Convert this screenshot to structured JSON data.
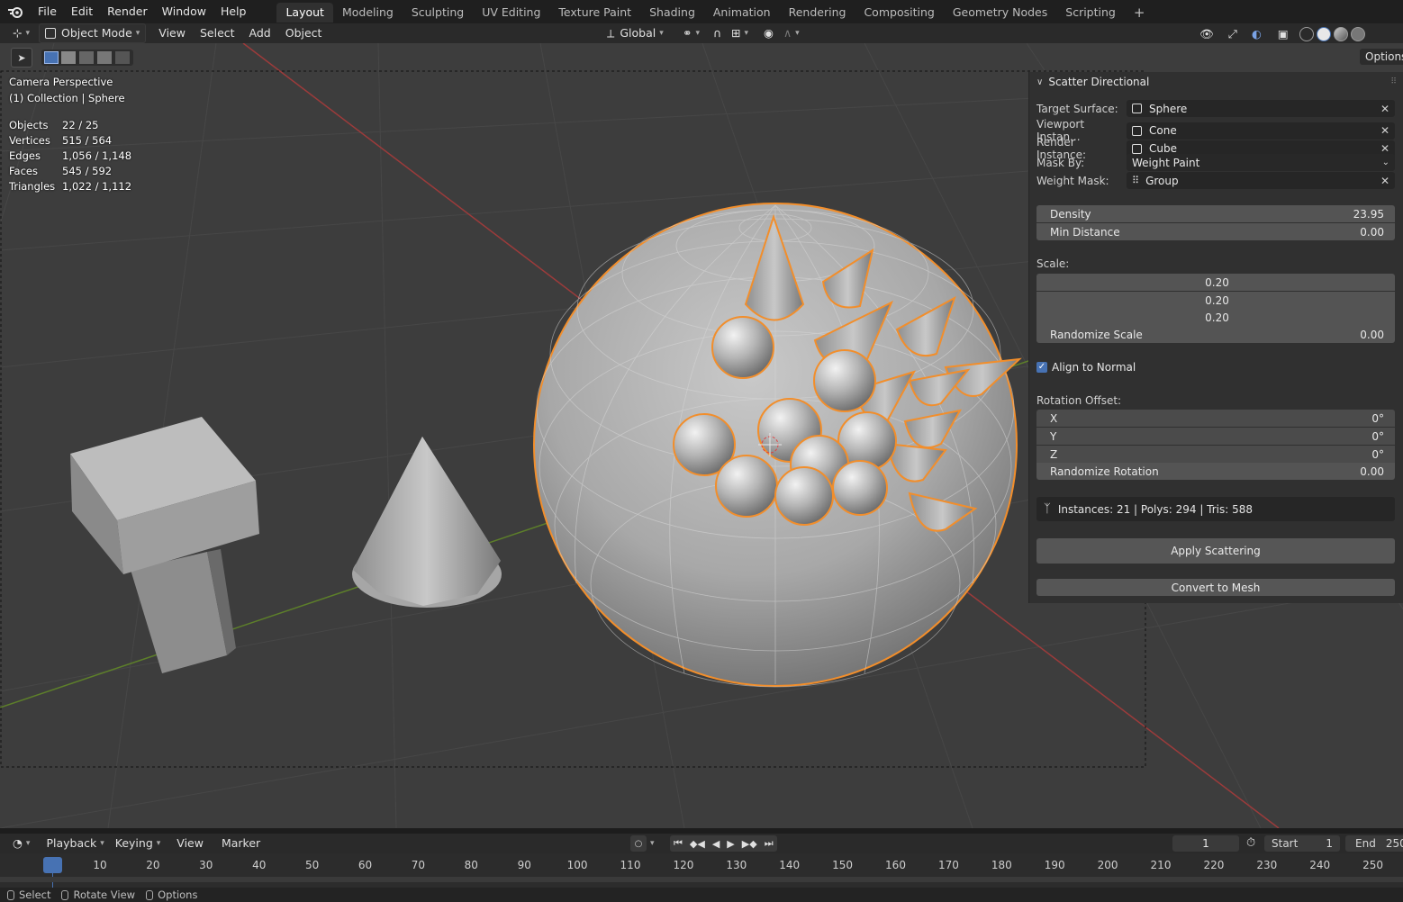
{
  "topbar": {
    "menus": [
      "File",
      "Edit",
      "Render",
      "Window",
      "Help"
    ],
    "workspace_tabs": [
      "Layout",
      "Modeling",
      "Sculpting",
      "UV Editing",
      "Texture Paint",
      "Shading",
      "Animation",
      "Rendering",
      "Compositing",
      "Geometry Nodes",
      "Scripting"
    ],
    "active_tab": "Layout",
    "add_tab": "+"
  },
  "header": {
    "mode": "Object Mode",
    "menus": [
      "View",
      "Select",
      "Add",
      "Object"
    ],
    "transform_orientation": "Global",
    "options_label": "Options"
  },
  "overlay": {
    "view_name": "Camera Perspective",
    "collection": "(1) Collection | Sphere",
    "stats": [
      {
        "label": "Objects",
        "value": "22 / 25"
      },
      {
        "label": "Vertices",
        "value": "515 / 564"
      },
      {
        "label": "Edges",
        "value": "1,056 / 1,148"
      },
      {
        "label": "Faces",
        "value": "545 / 592"
      },
      {
        "label": "Triangles",
        "value": "1,022 / 1,112"
      }
    ]
  },
  "panel": {
    "title": "Scatter Directional",
    "target_surface": {
      "label": "Target Surface:",
      "value": "Sphere"
    },
    "viewport_instance": {
      "label": "Viewport Instan...",
      "value": "Cone"
    },
    "render_instance": {
      "label": "Render Instance:",
      "value": "Cube"
    },
    "mask_by": {
      "label": "Mask By:",
      "value": "Weight Paint"
    },
    "weight_mask": {
      "label": "Weight Mask:",
      "value": "Group"
    },
    "density": {
      "label": "Density",
      "value": "23.95"
    },
    "min_distance": {
      "label": "Min Distance",
      "value": "0.00"
    },
    "scale_label": "Scale:",
    "scale": [
      "0.20",
      "0.20",
      "0.20"
    ],
    "randomize_scale": {
      "label": "Randomize Scale",
      "value": "0.00"
    },
    "align_to_normal": {
      "label": "Align to Normal",
      "checked": true
    },
    "rotation_offset_label": "Rotation Offset:",
    "rotation": [
      {
        "label": "X",
        "value": "0°"
      },
      {
        "label": "Y",
        "value": "0°"
      },
      {
        "label": "Z",
        "value": "0°"
      }
    ],
    "randomize_rotation": {
      "label": "Randomize Rotation",
      "value": "0.00"
    },
    "info": "Instances: 21 | Polys: 294 | Tris: 588",
    "apply_button": "Apply Scattering",
    "convert_button": "Convert to Mesh"
  },
  "timeline": {
    "menus": [
      "Playback",
      "Keying",
      "View",
      "Marker"
    ],
    "current_frame": "1",
    "start_label": "Start",
    "start_value": "1",
    "end_label": "End",
    "end_value": "250",
    "ticks": [
      "1",
      "10",
      "20",
      "30",
      "40",
      "50",
      "60",
      "70",
      "80",
      "90",
      "100",
      "110",
      "120",
      "130",
      "140",
      "150",
      "160",
      "170",
      "180",
      "190",
      "200",
      "210",
      "220",
      "230",
      "240",
      "250"
    ]
  },
  "statusbar": {
    "items": [
      "Select",
      "Rotate View",
      "Options"
    ]
  },
  "colors": {
    "selection_outline": "#f28e2b",
    "accent_blue": "#4772b3",
    "x_axis": "#c0413f",
    "y_axis": "#6d9a2c"
  }
}
